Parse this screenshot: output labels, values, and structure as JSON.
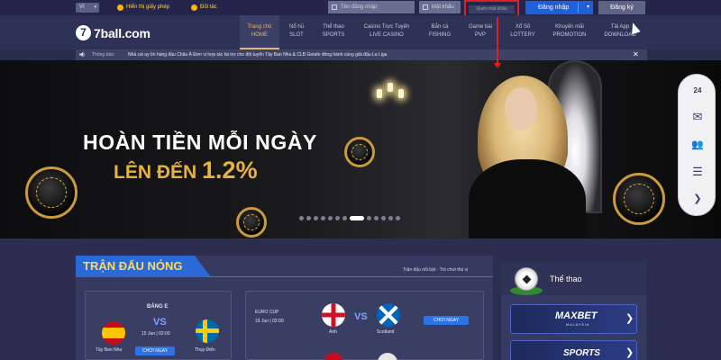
{
  "topbar": {
    "language": "VI",
    "license_label": "Hiển thị giấy phép",
    "partner_label": "Đối tác",
    "username_placeholder": "Tên đăng nhập",
    "password_placeholder": "Mật khẩu",
    "forgot_label": "Quên mật khẩu",
    "login_label": "Đăng nhập",
    "register_label": "Đăng ký"
  },
  "logo": {
    "mark": "7",
    "text": "7ball.com"
  },
  "nav": [
    {
      "vi": "Trang chủ",
      "en": "HOME"
    },
    {
      "vi": "Nổ hũ",
      "en": "SLOT"
    },
    {
      "vi": "Thể thao",
      "en": "SPORTS"
    },
    {
      "vi": "Casino Trực Tuyến",
      "en": "LIVE CASINO"
    },
    {
      "vi": "Bắn cá",
      "en": "FISHING"
    },
    {
      "vi": "Game bài",
      "en": "PVP"
    },
    {
      "vi": "Xổ Số",
      "en": "LOTTERY"
    },
    {
      "vi": "Khuyến mãi",
      "en": "PROMOTION"
    },
    {
      "vi": "Tải App",
      "en": "DOWNLOAD"
    }
  ],
  "notice": {
    "label": "Thông báo:",
    "message": "Nhà cái uy tín hàng đầu Châu Á Đơn vị hợp tác tài trợ cho đội tuyển Tây Ban Nha & CLB Getafe đồng hành cùng giải đấu La Liga",
    "close": "✕"
  },
  "banner": {
    "line1": "HOÀN TIỀN MỖI NGÀY",
    "line2": "LÊN ĐẾN",
    "percent": "1.2%",
    "slides": 13,
    "active_slide": 8
  },
  "side_icons": [
    "support-24-icon",
    "mail-icon",
    "users-icon",
    "menu-icon",
    "chevron-right-icon"
  ],
  "side_glyphs": {
    "support": "24",
    "mail": "✉",
    "users": "👥",
    "menu": "☰",
    "next": "❯"
  },
  "hot": {
    "title": "TRẬN ĐẤU NÓNG",
    "subtitle": "Trận đấu nổi bật · Trò chơi thú vị",
    "match1": {
      "group": "BẢNG E",
      "vs": "VS",
      "date": "15 Jun | 02:00",
      "team1": "Tây Ban Nha",
      "team2": "Thụy Điển",
      "bet": "CHƠI NGAY"
    },
    "match2": {
      "league": "EURO CUP",
      "date": "19 Jun | 02:00",
      "vs": "VS",
      "team1": "Anh",
      "team2": "Scotland",
      "bet": "CHƠI NGAY"
    }
  },
  "sports": {
    "title": "Thể thao",
    "row1": {
      "brand": "MAXBET",
      "sub": "MALAYSIA"
    },
    "row2": {
      "brand": "SPORTS"
    },
    "arrow": "❯"
  },
  "colors": {
    "accent_gold": "#e2b86b",
    "primary_blue": "#1f5fd9",
    "highlight_red": "#e01e25"
  }
}
